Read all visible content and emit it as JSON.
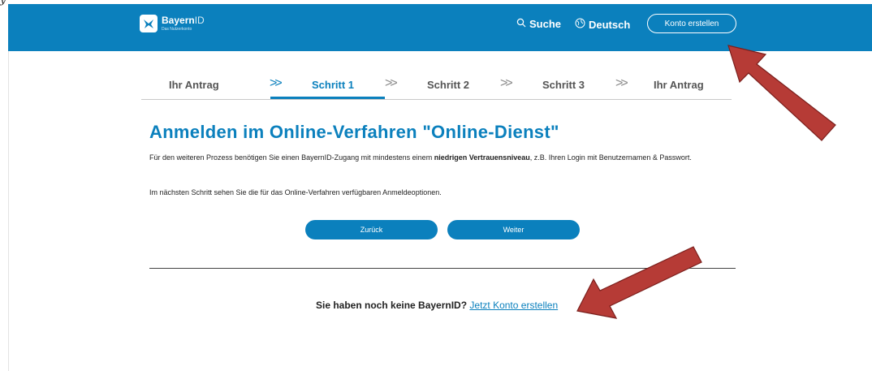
{
  "corner_text": "y",
  "header": {
    "logo_title": "Bayern",
    "logo_title_suffix": "ID",
    "logo_subtitle": "Das Nutzerkonto",
    "search_label": "Suche",
    "language_label": "Deutsch",
    "create_account_label": "Konto erstellen"
  },
  "steps": [
    {
      "label": "Ihr Antrag"
    },
    {
      "label": "Schritt 1"
    },
    {
      "label": "Schritt 2"
    },
    {
      "label": "Schritt 3"
    },
    {
      "label": "Ihr Antrag"
    }
  ],
  "main": {
    "heading": "Anmelden im Online-Verfahren \"Online-Dienst\"",
    "para1_before": "Für den weiteren Prozess benötigen Sie einen BayernID-Zugang mit mindestens einem ",
    "para1_bold": "niedrigen Vertrauensniveau",
    "para1_after": ", z.B. Ihren Login mit Benutzernamen & Passwort.",
    "para2": "Im nächsten Schritt sehen Sie die für das Online-Verfahren verfügbaren Anmeldeoptionen.",
    "back_label": "Zurück",
    "next_label": "Weiter"
  },
  "footer": {
    "question": "Sie haben noch keine BayernID?",
    "link": "Jetzt Konto erstellen"
  },
  "colors": {
    "brand": "#0b80bd",
    "annotation_arrow": "#b63b36"
  }
}
